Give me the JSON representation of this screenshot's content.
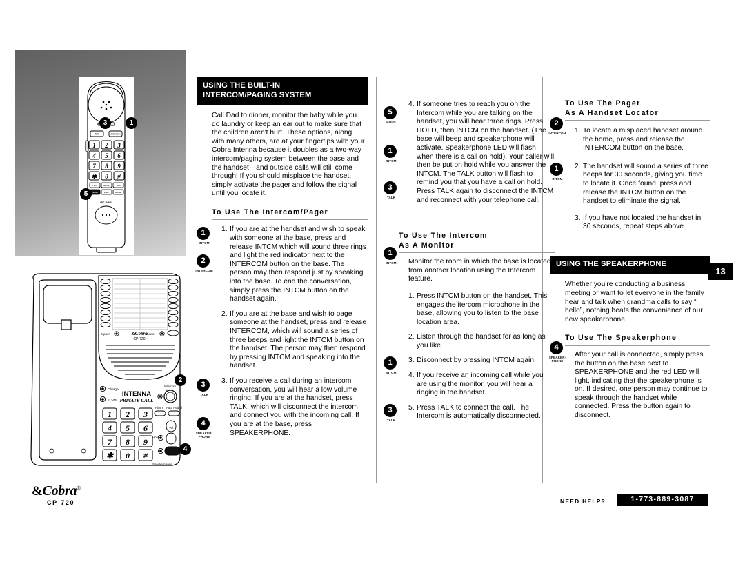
{
  "page": {
    "number": "13",
    "model": "CP-720",
    "brand": "Cobra",
    "brand_tm": "®",
    "need_help_label": "NEED HELP?",
    "support_phone": "1-773-889-3087"
  },
  "illustrations": {
    "handset": {
      "name": "cordless-handset",
      "buttons": [
        "Talk",
        "Intercom",
        "1",
        "2",
        "3",
        "4",
        "5",
        "6",
        "7",
        "8",
        "9",
        "✱",
        "0",
        "#",
        "Hold",
        "Memory",
        "Tone",
        "Intercom",
        "Flash",
        "Redial"
      ],
      "callouts": [
        {
          "num": "3",
          "label": "TALK"
        },
        {
          "num": "1",
          "label": "INTCM"
        },
        {
          "num": "5",
          "label": "HOLD"
        }
      ]
    },
    "base": {
      "name": "speakerphone-base",
      "brand": "Cobra",
      "model": "CP-720",
      "labels": [
        "Upper",
        "Lower",
        "Charge",
        "In Use",
        "INTENNA",
        "PRIVATE CALL",
        "Intercom",
        "Flash",
        "Auto Redial",
        "Hold",
        "Vol",
        "Speakerphone"
      ],
      "keypad": [
        "1",
        "2",
        "3",
        "4",
        "5",
        "6",
        "7",
        "8",
        "9",
        "✱",
        "0",
        "#"
      ],
      "callouts": [
        {
          "num": "2",
          "label": "INTERCOM"
        },
        {
          "num": "4",
          "label": "SPEAKERPHONE"
        }
      ]
    }
  },
  "col1": {
    "header": {
      "line1": "USING THE BUILT-IN",
      "line2": "INTERCOM/PAGING SYSTEM"
    },
    "intro": "Call Dad to dinner, monitor the baby while you do laundry or keep an ear out to make sure that the children aren't hurt. These options, along with many others, are at your fingertips with your Cobra Intenna because it doubles as a two-way intercom/paging system between the base and the handset—and outside calls will still come through! If you should misplace the handset, simply activate the pager and follow the signal until you locate it.",
    "subhead": {
      "line1": "To Use The Intercom/Pager"
    },
    "steps": [
      {
        "num": "1.",
        "text": "If you are at the handset and wish to speak with someone at the base, press and release INTCM which will sound three rings and light the red indicator next to the INTERCOM button on the base. The person may then respond just by  speaking into the base. To end the conversation, simply press the INTCM button on the handset again.",
        "badges": [
          {
            "num": "1",
            "label": "INTCM"
          },
          {
            "num": "2",
            "label": "INTERCOM"
          }
        ]
      },
      {
        "num": "2.",
        "text": "If you are at the base and wish to page someone at the handset, press and release INTERCOM, which will sound a series of three beeps and light the INTCM button on the handset. The person may then respond by pressing INTCM and speaking into the handset.",
        "badges": []
      },
      {
        "num": "3.",
        "text": "If you receive a call during an intercom conversation, you will hear a low volume ringing. If you are at the handset, press TALK, which will disconnect the intercom and connect you with the incoming call. If you are at the base, press SPEAKERPHONE.",
        "badges": [
          {
            "num": "3",
            "label": "TALK"
          },
          {
            "num": "4",
            "label": "SPEAKER-PHONE"
          }
        ]
      }
    ]
  },
  "col2": {
    "steps_top": [
      {
        "num": "4.",
        "text": "If someone tries to reach you on the Intercom while you are talking on the handset, you will hear three rings. Press HOLD, then INTCM on the handset. (The base will beep and speakerphone will activate. Speakerphone LED will flash when there is a call on hold). Your caller will then be put on hold while you answer the INTCM. The TALK button will flash to remind you that you have a call on hold. Press TALK again to disconnect the INTCM and reconnect with your telephone call.",
        "badges": [
          {
            "num": "5",
            "label": "HOLD"
          },
          {
            "num": "1",
            "label": "INTCM"
          },
          {
            "num": "3",
            "label": "TALK"
          }
        ]
      }
    ],
    "subhead": {
      "line1": "To Use The Intercom",
      "line2": "As A Monitor"
    },
    "intro": "Monitor the room in which the base  is located from another location using the Intercom feature.",
    "intro_badge": {
      "num": "1",
      "label": "INTCM"
    },
    "steps": [
      {
        "num": "1.",
        "text": "Press INTCM button on the handset. This engages the itercom microphone in the base, allowing you to listen to the base location area.",
        "badges": []
      },
      {
        "num": "2.",
        "text": "Listen through the handset for as long as you like.",
        "badges": []
      },
      {
        "num": "3.",
        "text": "Disconnect by pressing INTCM again.",
        "badges": [
          {
            "num": "1",
            "label": "INTCM"
          }
        ]
      },
      {
        "num": "4.",
        "text": "If you receive an incoming call while you are using the monitor, you will hear a ringing in the handset.",
        "badges": []
      },
      {
        "num": "5.",
        "text": "Press TALK to connect the call. The Intercom is automatically disconnected.",
        "badges": [
          {
            "num": "3",
            "label": "TALK"
          }
        ]
      }
    ]
  },
  "col3": {
    "subhead": {
      "line1": "To Use The Pager",
      "line2": "As A Handset Locator"
    },
    "steps": [
      {
        "num": "1.",
        "text": "To locate a misplaced handset around the home, press  and release the INTERCOM button on the base.",
        "badges": [
          {
            "num": "2",
            "label": "INTERCOM"
          }
        ]
      },
      {
        "num": "2.",
        "text": "The handset will sound a series of three beeps for 30 seconds, giving you time to  locate it. Once found, press and release the INTCM button on the handset to eliminate the signal.",
        "badges": [
          {
            "num": "1",
            "label": "INTCM"
          }
        ]
      },
      {
        "num": "3.",
        "text": "If you have not located the handset in 30 seconds, repeat steps above.",
        "badges": []
      }
    ],
    "header": {
      "line1": "USING THE SPEAKERPHONE"
    },
    "intro": "Whether you're conducting a business meeting or want to let everyone in the family hear and talk when grandma calls to say “ hello”, nothing beats the convenience of our new speakerphone.",
    "subhead2": {
      "line1": "To Use The Speakerphone"
    },
    "body2": "After your call is connected, simply press the button on the base next to SPEAKERPHONE and the red LED will light, indicating that the speakerphone is on.  If desired, one person may continue to speak through the handset while connected. Press the button again to disconnect.",
    "body2_badge": {
      "num": "4",
      "label": "SPEAKER-PHONE"
    }
  }
}
